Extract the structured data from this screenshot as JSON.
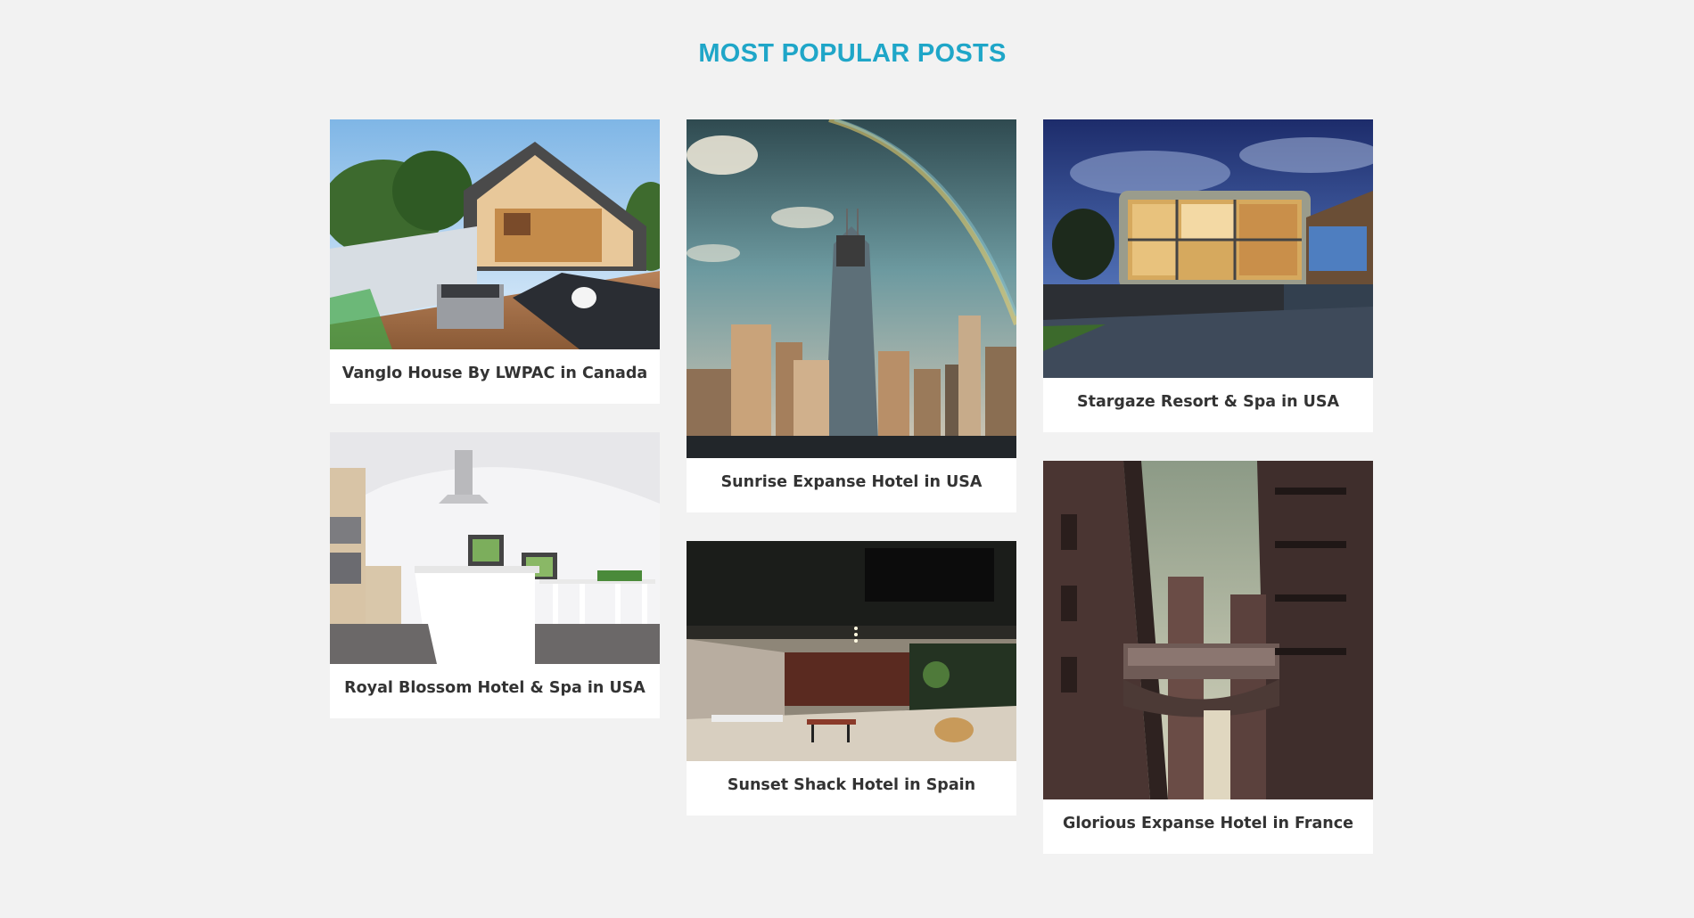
{
  "section": {
    "title": "MOST POPULAR POSTS"
  },
  "posts": [
    {
      "title": "Vanglo House By LWPAC in Canada",
      "image": "rooftop-terrace-house-photo"
    },
    {
      "title": "Royal Blossom Hotel & Spa in USA",
      "image": "white-kitchen-interior-photo"
    },
    {
      "title": "Sunrise Expanse Hotel in USA",
      "image": "city-skyline-rainbow-photo"
    },
    {
      "title": "Sunset Shack Hotel in Spain",
      "image": "dark-lobby-interior-photo"
    },
    {
      "title": "Stargaze Resort & Spa in USA",
      "image": "glass-house-night-photo"
    },
    {
      "title": "Glorious Expanse Hotel in France",
      "image": "alley-skybridge-photo"
    }
  ],
  "colors": {
    "background": "#f2f2f2",
    "accent": "#1fa6c8",
    "card": "#ffffff",
    "caption_text": "#333333"
  }
}
